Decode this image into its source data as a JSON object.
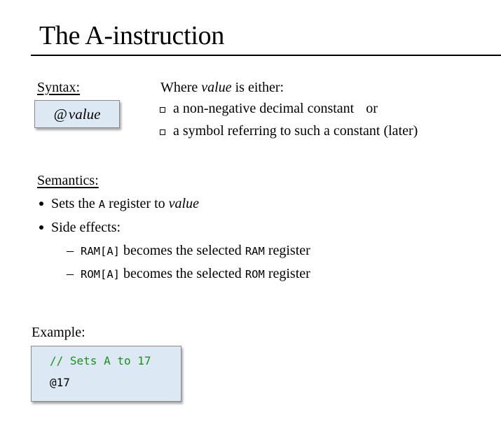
{
  "title": "The A-instruction",
  "syntax": {
    "label": "Syntax:",
    "at": "@",
    "value_word": "value"
  },
  "where": {
    "prefix": "Where ",
    "value_word": "value",
    "suffix": " is either:",
    "items": [
      {
        "text": "a non-negative decimal constant",
        "tail": "or"
      },
      {
        "text": "a symbol referring to such a constant (later)"
      }
    ]
  },
  "semantics": {
    "label": "Semantics:",
    "bullet1": {
      "prefix": "Sets the ",
      "code": "A",
      "middle": " register to ",
      "value_word": "value"
    },
    "bullet2": {
      "text": "Side effects:"
    },
    "sub": [
      {
        "dash": "–",
        "code": "RAM[A]",
        "middle": " becomes the selected ",
        "code2": "RAM",
        "suffix": " register"
      },
      {
        "dash": "–",
        "code": "ROM[A]",
        "middle": " becomes the selected ",
        "code2": "ROM",
        "suffix": " register"
      }
    ]
  },
  "example": {
    "label": "Example:",
    "comment": "// Sets A to 17",
    "code": "@17",
    "comment_color": "#1a8f1a",
    "box_color": "#dce9f5"
  }
}
